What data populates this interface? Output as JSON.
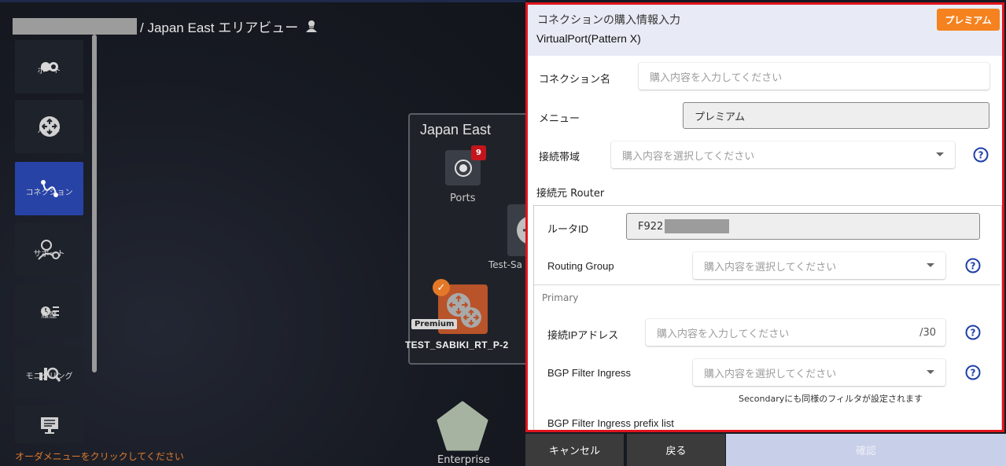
{
  "breadcrumb": {
    "text": "/ Japan East エリアビュー"
  },
  "nav": {
    "items": [
      {
        "label": "ポート",
        "icon": "toggle-icon"
      },
      {
        "label": "ルータ",
        "icon": "router-icon"
      },
      {
        "label": "コネクション",
        "icon": "connection-icon",
        "active": true
      },
      {
        "label": "サポート",
        "icon": "support-icon"
      },
      {
        "label": "履歴",
        "icon": "history-icon"
      },
      {
        "label": "モニタリング",
        "icon": "monitoring-icon"
      },
      {
        "label": "",
        "icon": "monitor-icon"
      }
    ],
    "hint": "オーダメニューをクリックしてください"
  },
  "canvas": {
    "area_title": "Japan East",
    "ports_label": "Ports",
    "ports_badge": "9",
    "test_label": "Test-Sa",
    "router_label": "TEST_SABIKI_RT_P-2",
    "router_tag": "Premium",
    "enterprise_label": "Enterprise"
  },
  "panel": {
    "title": "コネクションの購入情報入力",
    "subtitle": "VirtualPort(Pattern X)",
    "premium_button": "プレミアム",
    "connection_name": {
      "label": "コネクション名",
      "placeholder": "購入内容を入力してください"
    },
    "menu": {
      "label": "メニュー",
      "value": "プレミアム"
    },
    "bandwidth": {
      "label": "接続帯域",
      "placeholder": "購入内容を選択してください"
    },
    "source_router": {
      "title": "接続元 Router",
      "router_id": {
        "label": "ルータID",
        "value": "F922"
      },
      "routing_group": {
        "label": "Routing Group",
        "placeholder": "購入内容を選択してください"
      },
      "primary_label": "Primary",
      "ip_address": {
        "label": "接続IPアドレス",
        "placeholder": "購入内容を入力してください",
        "suffix": "/30"
      },
      "bgp_ingress": {
        "label": "BGP Filter Ingress",
        "placeholder": "購入内容を選択してください",
        "note": "Secondaryにも同様のフィルタが設定されます"
      },
      "bgp_ingress_prefix": {
        "label": "BGP Filter Ingress prefix list"
      }
    }
  },
  "buttons": {
    "cancel": "キャンセル",
    "back": "戻る",
    "confirm": "確認"
  },
  "colors": {
    "accent": "#2743a6",
    "premium": "#f5821f",
    "highlight_border": "#e0141c",
    "router_tile": "#b8532a"
  }
}
